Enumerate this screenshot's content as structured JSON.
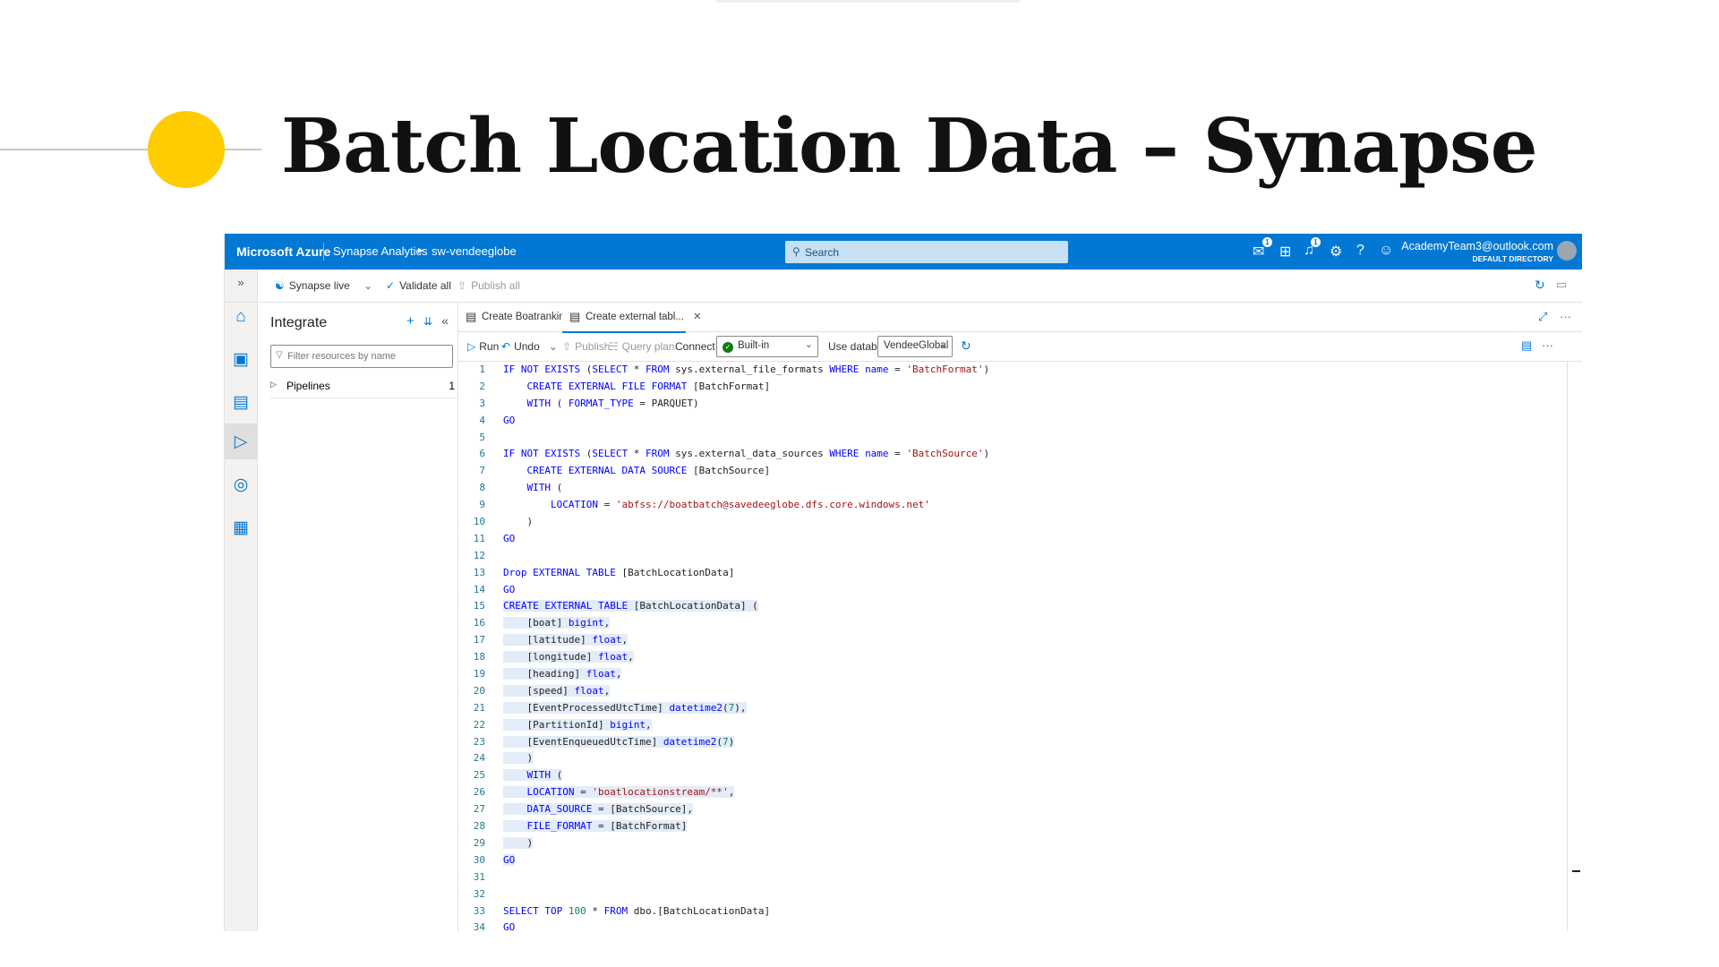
{
  "slide": {
    "title": "Batch Location Data – Synapse"
  },
  "topbar": {
    "brand": "Microsoft Azure",
    "breadcrumb": [
      "Synapse Analytics",
      "sw-vendeeglobe"
    ],
    "search_placeholder": "Search",
    "account_email": "AcademyTeam3@outlook.com",
    "account_directory": "DEFAULT DIRECTORY",
    "notification_badges": [
      "1",
      "1"
    ]
  },
  "command_bar": {
    "synapse_live": "Synapse live",
    "validate_all": "Validate all",
    "publish_all": "Publish all"
  },
  "resources": {
    "title": "Integrate",
    "filter_placeholder": "Filter resources by name",
    "items": [
      {
        "label": "Pipelines",
        "count": "1"
      }
    ]
  },
  "tabs": [
    {
      "label": "Create Boatranking a..."
    },
    {
      "label": "Create external tabl..."
    }
  ],
  "editor_toolbar": {
    "run": "Run",
    "undo": "Undo",
    "publish": "Publish",
    "query_plan": "Query plan",
    "connect_to_label": "Connect to",
    "connect_to_value": "Built-in",
    "use_database_label": "Use database",
    "use_database_value": "VendeeGlobal"
  },
  "code_lines": [
    "IF NOT EXISTS (SELECT * FROM sys.external_file_formats WHERE name = 'BatchFormat')",
    "    CREATE EXTERNAL FILE FORMAT [BatchFormat]",
    "    WITH ( FORMAT_TYPE = PARQUET)",
    "GO",
    "",
    "IF NOT EXISTS (SELECT * FROM sys.external_data_sources WHERE name = 'BatchSource')",
    "    CREATE EXTERNAL DATA SOURCE [BatchSource]",
    "    WITH (",
    "        LOCATION = 'abfss://boatbatch@savedeeglobe.dfs.core.windows.net'",
    "    )",
    "GO",
    "",
    "Drop EXTERNAL TABLE [BatchLocationData]",
    "GO",
    "CREATE EXTERNAL TABLE [BatchLocationData] (",
    "    [boat] bigint,",
    "    [latitude] float,",
    "    [longitude] float,",
    "    [heading] float,",
    "    [speed] float,",
    "    [EventProcessedUtcTime] datetime2(7),",
    "    [PartitionId] bigint,",
    "    [EventEnqueuedUtcTime] datetime2(7)",
    "    )",
    "    WITH (",
    "    LOCATION = 'boatlocationstream/**',",
    "    DATA_SOURCE = [BatchSource],",
    "    FILE_FORMAT = [BatchFormat]",
    "    )",
    "GO",
    "",
    "",
    "SELECT TOP 100 * FROM dbo.[BatchLocationData]",
    "GO"
  ],
  "colors": {
    "accent": "#0078d4",
    "slide_circle": "#ffcc00",
    "keyword": "#0000ff",
    "string": "#a31515",
    "number": "#098658",
    "line_number": "#237893"
  }
}
